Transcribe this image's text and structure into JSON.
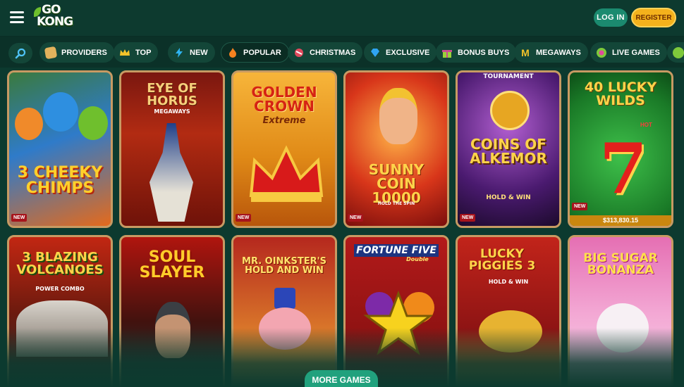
{
  "header": {
    "logo_top": "GO",
    "logo_bottom": "KONG",
    "login_label": "LOG IN",
    "register_label": "REGISTER"
  },
  "categories": [
    {
      "label": "PROVIDERS",
      "icon": "scroll-icon",
      "color": "#e2b25c"
    },
    {
      "label": "TOP",
      "icon": "crown-icon",
      "color": "#f2c22a"
    },
    {
      "label": "NEW",
      "icon": "lightning-icon",
      "color": "#2fb4f2"
    },
    {
      "label": "POPULAR",
      "icon": "fire-icon",
      "color": "#f5821f"
    },
    {
      "label": "CHRISTMAS",
      "icon": "candy-icon",
      "color": "#e04a5d"
    },
    {
      "label": "EXCLUSIVE",
      "icon": "diamond-icon",
      "color": "#2fa4f2"
    },
    {
      "label": "BONUS BUYS",
      "icon": "gift-icon",
      "color": "#9ad13a"
    },
    {
      "label": "MEGAWAYS",
      "icon": "megaways-icon",
      "color": "#f2c22a"
    },
    {
      "label": "LIVE GAMES",
      "icon": "chip-icon",
      "color": "#7ec93b"
    }
  ],
  "games": [
    {
      "title": "3 CHEEKY CHIMPS",
      "badge": "NEW"
    },
    {
      "title": "EYE OF HORUS",
      "subtitle": "MEGAWAYS"
    },
    {
      "title": "GOLDEN CROWN",
      "subtitle": "Extreme",
      "badge": "NEW"
    },
    {
      "title": "SUNNY COIN 10000",
      "subtitle": "HOLD THE SPIN",
      "badge": "NEW"
    },
    {
      "title": "COINS OF ALKEMOR",
      "top_label": "TOURNAMENT",
      "subtitle": "HOLD & WIN",
      "badge": "NEW"
    },
    {
      "title": "40 LUCKY WILDS",
      "tag": "HOT",
      "badge": "NEW",
      "jackpot": "$313,830.15"
    },
    {
      "title": "3 BLAZING VOLCANOES",
      "subtitle": "POWER COMBO"
    },
    {
      "title": "SOUL SLAYER"
    },
    {
      "title": "MR. OINKSTER'S HOLD AND WIN"
    },
    {
      "title": "FORTUNE FIVE",
      "subtitle": "Double"
    },
    {
      "title": "LUCKY PIGGIES 3",
      "subtitle": "HOLD & WIN"
    },
    {
      "title": "BIG SUGAR BONANZA"
    }
  ],
  "more_label": "MORE GAMES"
}
